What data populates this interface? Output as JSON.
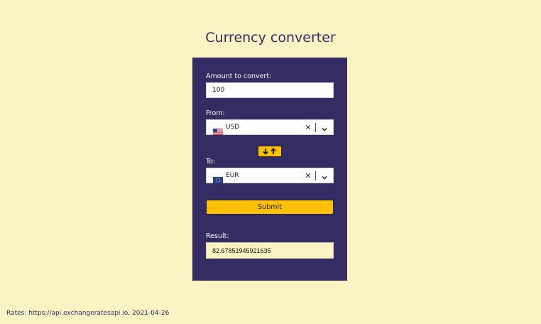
{
  "page": {
    "title": "Currency converter"
  },
  "form": {
    "amount_label": "Amount to convert:",
    "amount_value": "100",
    "from_label": "From:",
    "from_currency": "USD",
    "from_flag_icon": "us-flag-icon",
    "to_label": "To:",
    "to_currency": "EUR",
    "to_flag_icon": "eu-flag-icon",
    "swap_icon": "swap-arrows-icon",
    "submit_label": "Submit",
    "result_label": "Result:",
    "result_value": "82.67851945921635"
  },
  "footer": {
    "rates_text": "Rates: https://api.exchangeratesapi.io, 2021-04-26"
  },
  "colors": {
    "background": "#faf4c4",
    "panel": "#352c64",
    "accent": "#ffc107"
  }
}
